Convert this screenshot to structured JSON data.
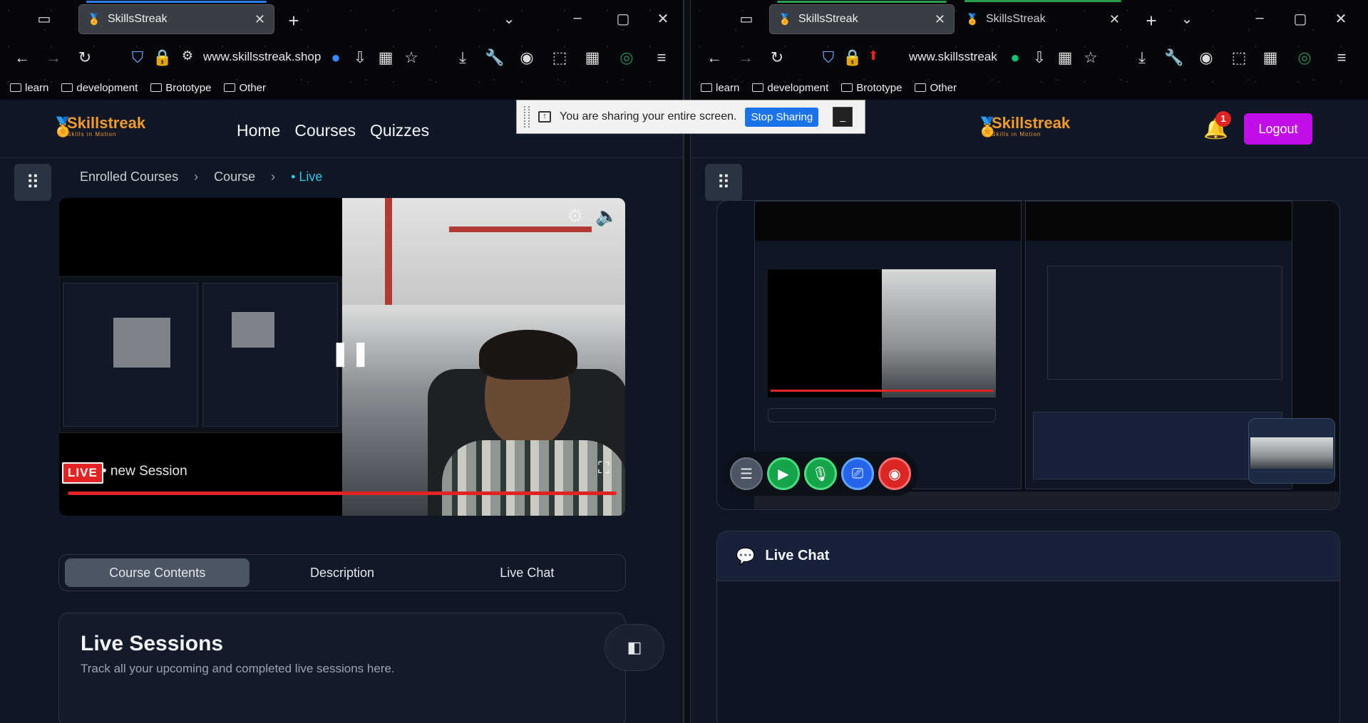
{
  "left_window": {
    "tab": {
      "title": "SkillsStreak",
      "close": "✕"
    },
    "new_tab": "+",
    "url": "www.skillsstreak.shop",
    "bookmarks": [
      "learn",
      "development",
      "Brototype",
      "Other"
    ],
    "site": {
      "logo_name": "Skillstreak",
      "logo_tagline": "Skills in Motion",
      "nav": [
        "Home",
        "Courses",
        "Quizzes"
      ]
    },
    "breadcrumb": [
      "Enrolled Courses",
      "Course",
      "• Live"
    ],
    "player": {
      "live_badge": "LIVE",
      "session": "• new Session",
      "progress": 1.0
    },
    "tabs": [
      "Course Contents",
      "Description",
      "Live Chat"
    ],
    "active_tab": "Course Contents",
    "sessions": {
      "title": "Live Sessions",
      "subtitle": "Track all your upcoming and completed live sessions here."
    }
  },
  "share_bar": {
    "text": "You are sharing your entire screen.",
    "stop": "Stop Sharing",
    "hide": "_"
  },
  "right_window": {
    "tabs": [
      {
        "title": "SkillsStreak",
        "close": "✕"
      },
      {
        "title": "SkillsStreak",
        "close": "✕"
      }
    ],
    "new_tab": "+",
    "url": "www.skillsstreak",
    "bookmarks": [
      "learn",
      "development",
      "Brototype",
      "Other"
    ],
    "site": {
      "logo_name": "Skillstreak",
      "logo_tagline": "Skills in Motion"
    },
    "notifications": "1",
    "logout": "Logout",
    "chat": {
      "title": "Live Chat"
    }
  },
  "colors": {
    "accent": "#c20de8",
    "live": "#e02424",
    "brand": "#f29a2e",
    "link": "#2ec5e8"
  },
  "icons": [
    "tab-list-icon",
    "back-icon",
    "forward-icon",
    "reload-icon",
    "shield-icon",
    "lock-icon",
    "star-icon",
    "download-icon",
    "wrench-icon",
    "account-icon",
    "extensions-icon",
    "menu-icon",
    "settings-icon",
    "volume-icon",
    "pause-icon",
    "fullscreen-icon",
    "apps-grid-icon",
    "sidebar-panel-icon",
    "bell-icon",
    "video-icon",
    "mic-icon",
    "screen-share-icon",
    "end-call-icon",
    "chat-icon"
  ]
}
